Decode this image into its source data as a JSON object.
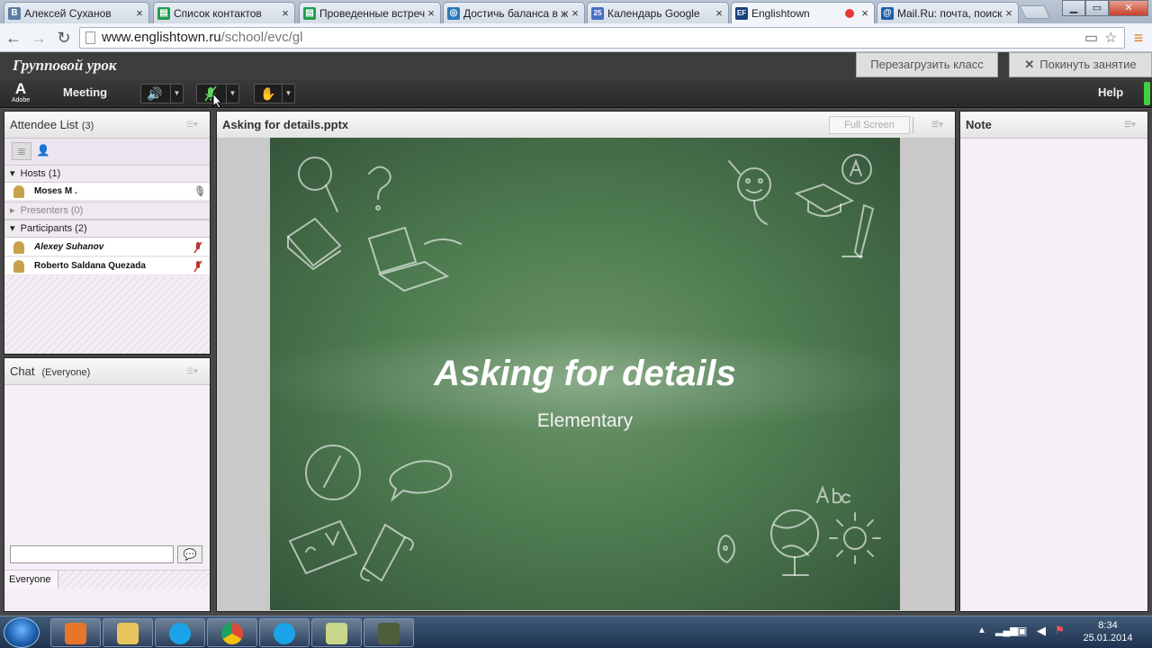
{
  "browser": {
    "tabs": [
      {
        "label": "Алексей Суханов",
        "icon": "vk-icon",
        "color": "#5b7fa6",
        "glyph": "В"
      },
      {
        "label": "Список контактов",
        "icon": "sheets-icon",
        "color": "#1e9e4d",
        "glyph": "▤"
      },
      {
        "label": "Проведенные встреч",
        "icon": "sheets-icon",
        "color": "#1e9e4d",
        "glyph": "▤"
      },
      {
        "label": "Достичь баланса в ж",
        "icon": "site-icon",
        "color": "#2a7ab8",
        "glyph": "◎"
      },
      {
        "label": "Календарь Google",
        "icon": "calendar-icon",
        "color": "#4a6fc4",
        "glyph": "25"
      },
      {
        "label": "Englishtown",
        "icon": "ef-icon",
        "color": "#1a3f7a",
        "glyph": "EF"
      },
      {
        "label": "Mail.Ru: почта, поиск",
        "icon": "mailru-icon",
        "color": "#1d5fa8",
        "glyph": "@"
      }
    ],
    "url_host": "www.englishtown.ru",
    "url_path": "/school/evc/gl"
  },
  "header": {
    "title": "Групповой урок",
    "reload_label": "Перезагрузить класс",
    "leave_label": "Покинуть занятие"
  },
  "menu": {
    "meeting_label": "Meeting",
    "help_label": "Help"
  },
  "attendees": {
    "title": "Attendee List",
    "count": "(3)",
    "hosts_label": "Hosts (1)",
    "hosts": [
      "Moses M ."
    ],
    "presenters_label": "Presenters (0)",
    "participants_label": "Participants (2)",
    "participants": [
      "Alexey Suhanov",
      "Roberto Saldana  Quezada"
    ]
  },
  "chat": {
    "title": "Chat",
    "scope": "(Everyone)",
    "tab_label": "Everyone"
  },
  "share": {
    "title": "Asking for details.pptx",
    "fullscreen_label": "Full Screen",
    "slide_title": "Asking for details",
    "slide_subtitle": "Elementary"
  },
  "note": {
    "title": "Note"
  },
  "taskbar": {
    "apps": [
      {
        "icon": "media-player-icon",
        "color": "#e8762a"
      },
      {
        "icon": "file-explorer-icon",
        "color": "#e9c45c"
      },
      {
        "icon": "skype-icon",
        "color": "#1aa3e8"
      },
      {
        "icon": "chrome-icon",
        "color": "#de4b39"
      },
      {
        "icon": "skype-icon",
        "color": "#1aa3e8"
      },
      {
        "icon": "sticky-notes-icon",
        "color": "#c9d78a"
      },
      {
        "icon": "camera-app-icon",
        "color": "#4e5d3a"
      }
    ],
    "time": "8:34",
    "date": "25.01.2014"
  }
}
